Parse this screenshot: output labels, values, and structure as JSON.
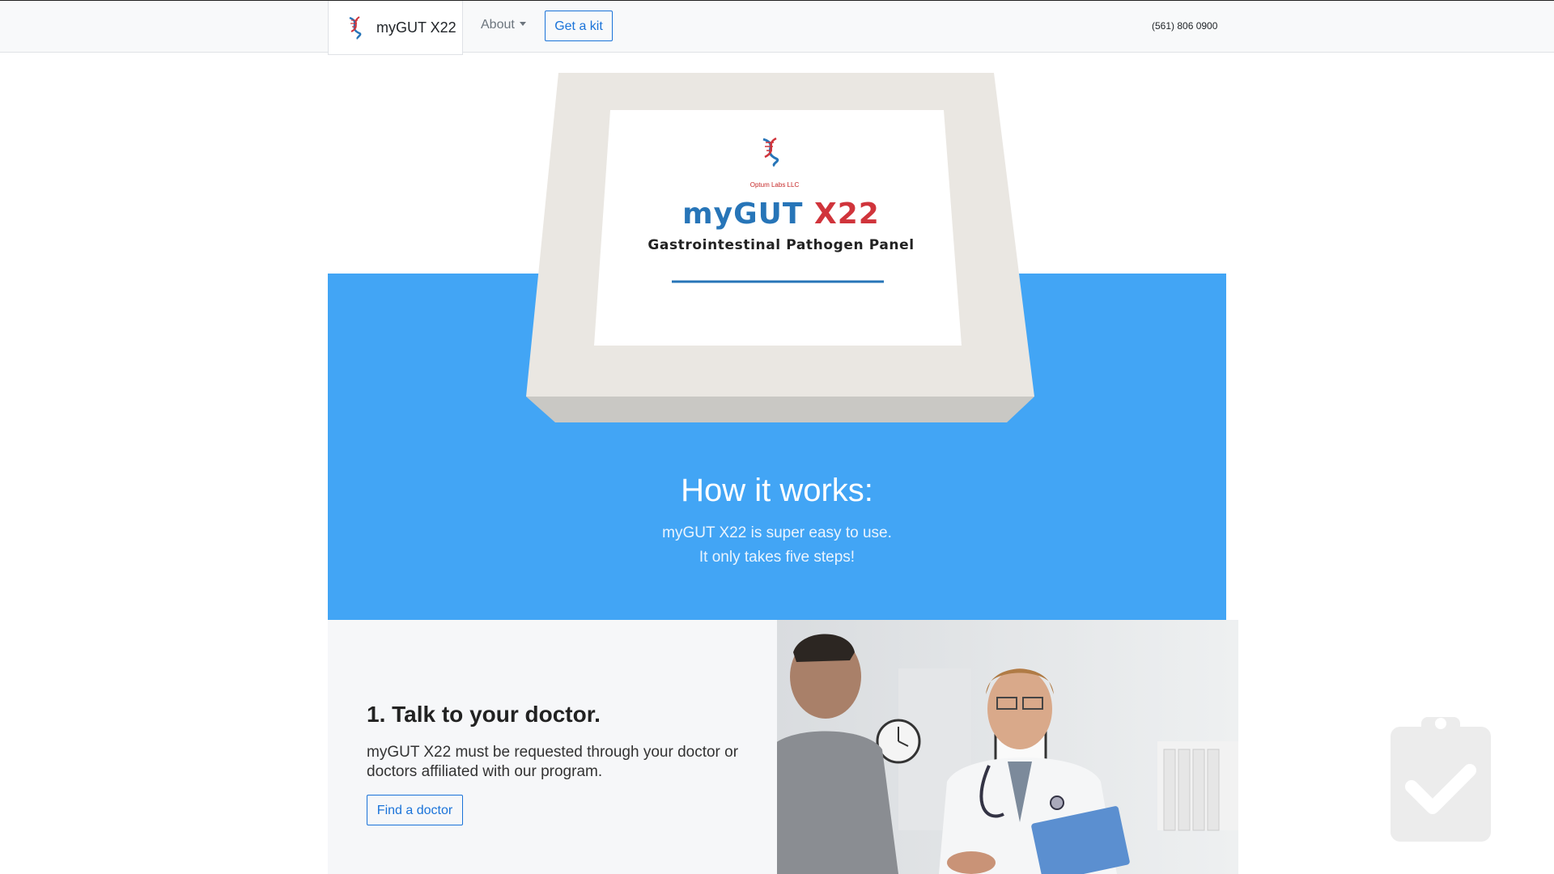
{
  "nav": {
    "brand": "myGUT X22",
    "about": "About",
    "get_kit": "Get a kit",
    "phone": "(561) 806 0900"
  },
  "box": {
    "company": "Optum Labs LLC",
    "title_main": "myGUT",
    "title_accent": "X22",
    "subtitle": "Gastrointestinal Pathogen Panel"
  },
  "hero": {
    "title": "How it works:",
    "line1": "myGUT X22 is super easy to use.",
    "line2": "It only takes five steps!"
  },
  "step1": {
    "title": "1. Talk to your doctor.",
    "text": "myGUT X22 must be requested through your doctor or doctors affiliated with our program.",
    "button": "Find a doctor"
  },
  "colors": {
    "hero_blue": "#42a5f5",
    "accent_blue": "#1a73d9",
    "brand_blue": "#2775b8",
    "brand_red": "#d0343b"
  },
  "icons": [
    "dna-logo-icon",
    "clipboard-check-icon"
  ]
}
